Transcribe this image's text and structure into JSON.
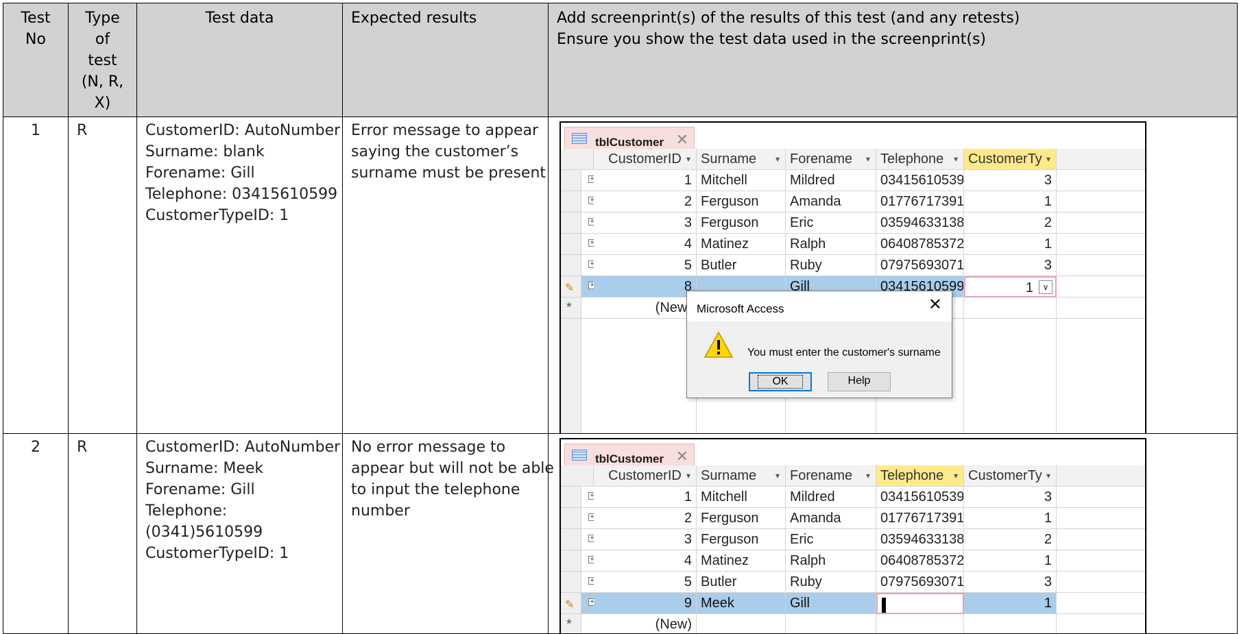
{
  "header": {
    "test_no": [
      "Test",
      "No"
    ],
    "type_of_test": [
      "Type of",
      "test",
      "(N, R,",
      "X)"
    ],
    "test_data": "Test data",
    "expected_results": "Expected results",
    "screenprint": [
      "Add screenprint(s) of the results of this test (and any retests)",
      "Ensure you show the test data used in the screenprint(s)"
    ]
  },
  "rows": [
    {
      "test_no": "1",
      "type": "R",
      "test_data": [
        "CustomerID: AutoNumber",
        "Surname: blank",
        "Forename: Gill",
        "Telephone: 03415610599",
        "CustomerTypeID: 1"
      ],
      "expected": [
        "Error message to appear",
        "saying the customer’s",
        "surname must be present"
      ]
    },
    {
      "test_no": "2",
      "type": "R",
      "test_data": [
        "CustomerID: AutoNumber",
        "Surname: Meek",
        "Forename: Gill",
        "Telephone:",
        "(0341)5610599",
        "CustomerTypeID: 1"
      ],
      "expected": [
        "No error message to",
        "appear but will not be able",
        "to input the telephone",
        "number"
      ]
    }
  ],
  "access": {
    "tab_name": "tblCustomer",
    "columns": [
      "CustomerID",
      "Surname",
      "Forename",
      "Telephone",
      "CustomerTy"
    ],
    "records": [
      {
        "id": "1",
        "surname": "Mitchell",
        "forename": "Mildred",
        "telephone": "03415610539",
        "type": "3"
      },
      {
        "id": "2",
        "surname": "Ferguson",
        "forename": "Amanda",
        "telephone": "01776717391",
        "type": "1"
      },
      {
        "id": "3",
        "surname": "Ferguson",
        "forename": "Eric",
        "telephone": "03594633138",
        "type": "2"
      },
      {
        "id": "4",
        "surname": "Matinez",
        "forename": "Ralph",
        "telephone": "06408785372",
        "type": "1"
      },
      {
        "id": "5",
        "surname": "Butler",
        "forename": "Ruby",
        "telephone": "07975693071",
        "type": "3"
      }
    ],
    "new_row_label": "(New)",
    "shot1_edit": {
      "id": "8",
      "surname": "",
      "forename": "Gill",
      "telephone": "03415610599",
      "type": "1"
    },
    "shot2_edit": {
      "id": "9",
      "surname": "Meek",
      "forename": "Gill",
      "telephone": "",
      "type": "1"
    },
    "dialog": {
      "title": "Microsoft Access",
      "message": "You must enter the customer's surname",
      "ok_label": "OK",
      "help_label": "Help"
    }
  },
  "colors": {
    "header_bg": "#d2d2d2",
    "selected_row": "#a9cdea",
    "highlight_header": "#ffe98a",
    "tab_bg": "#f9dede"
  }
}
